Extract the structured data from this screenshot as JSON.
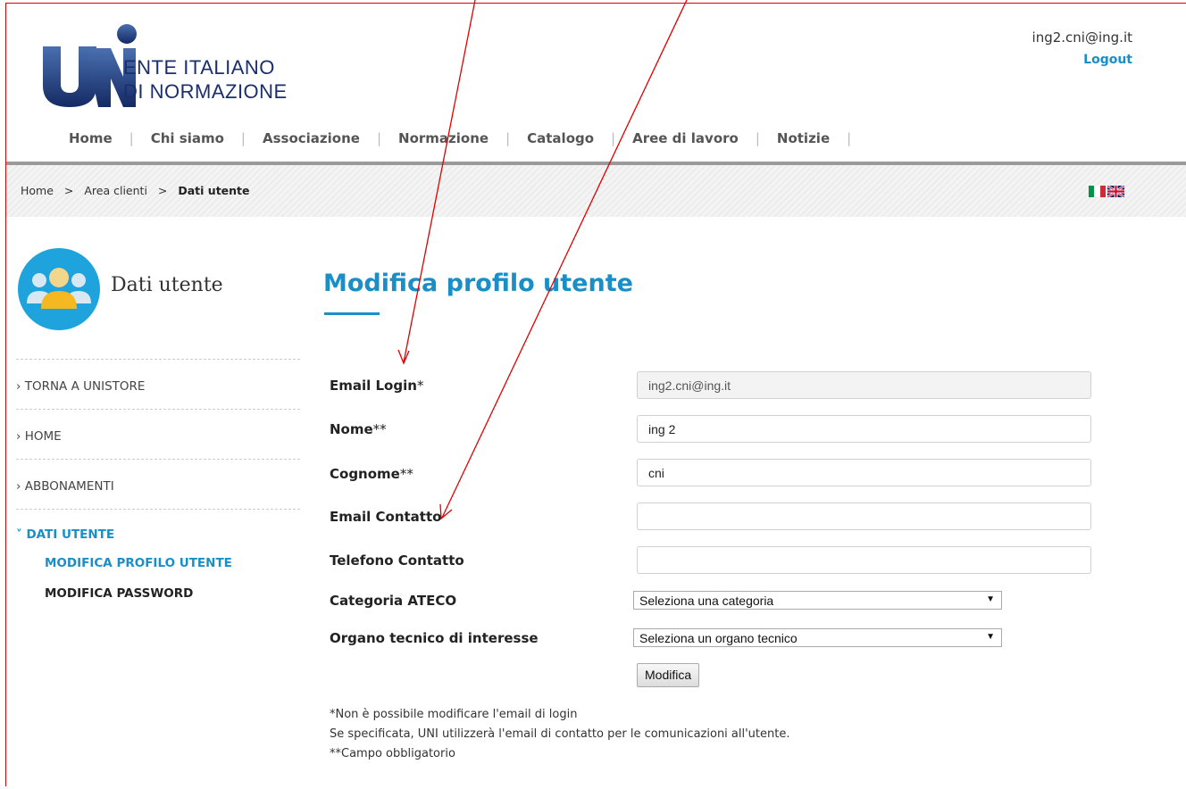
{
  "brand": {
    "logo_mark": "UNI",
    "logo_line1": "ENTE ITALIANO",
    "logo_line2": "DI NORMAZIONE",
    "accent_color": "#1a8fc7",
    "logo_color": "#1a2f6b"
  },
  "account": {
    "email": "ing2.cni@ing.it",
    "logout_label": "Logout"
  },
  "nav": {
    "items": [
      "Home",
      "Chi siamo",
      "Associazione",
      "Normazione",
      "Catalogo",
      "Aree di lavoro",
      "Notizie"
    ]
  },
  "breadcrumb": {
    "items": [
      "Home",
      "Area clienti",
      "Dati utente"
    ],
    "separator": ">"
  },
  "languages": [
    "it-flag-icon",
    "uk-flag-icon"
  ],
  "sidebar": {
    "title": "Dati utente",
    "items": [
      {
        "label": "TORNA A UNISTORE",
        "marker": "›"
      },
      {
        "label": "HOME",
        "marker": "›"
      },
      {
        "label": "ABBONAMENTI",
        "marker": "›"
      },
      {
        "label": "DATI UTENTE",
        "marker": "˅"
      }
    ],
    "subitems": [
      {
        "label": "MODIFICA PROFILO UTENTE"
      },
      {
        "label": "MODIFICA PASSWORD"
      }
    ]
  },
  "main": {
    "title": "Modifica profilo utente",
    "fields": [
      {
        "label": "Email Login",
        "req": "*",
        "value": "ing2.cni@ing.it"
      },
      {
        "label": "Nome",
        "req": "**",
        "value": "ing 2"
      },
      {
        "label": "Cognome",
        "req": "**",
        "value": "cni"
      },
      {
        "label": "Email Contatto",
        "req": "",
        "value": ""
      },
      {
        "label": "Telefono Contatto",
        "req": "",
        "value": ""
      }
    ],
    "selects": [
      {
        "label": "Categoria ATECO",
        "value": "Seleziona una categoria"
      },
      {
        "label": "Organo tecnico di interesse",
        "value": "Seleziona un organo tecnico"
      }
    ],
    "submit_label": "Modifica",
    "notes": [
      "*Non è possibile modificare l'email di login",
      "Se specificata, UNI utilizzerà l'email di contatto per le comunicazioni all'utente.",
      "**Campo obbligatorio"
    ]
  },
  "annotation_color": "#e00000"
}
